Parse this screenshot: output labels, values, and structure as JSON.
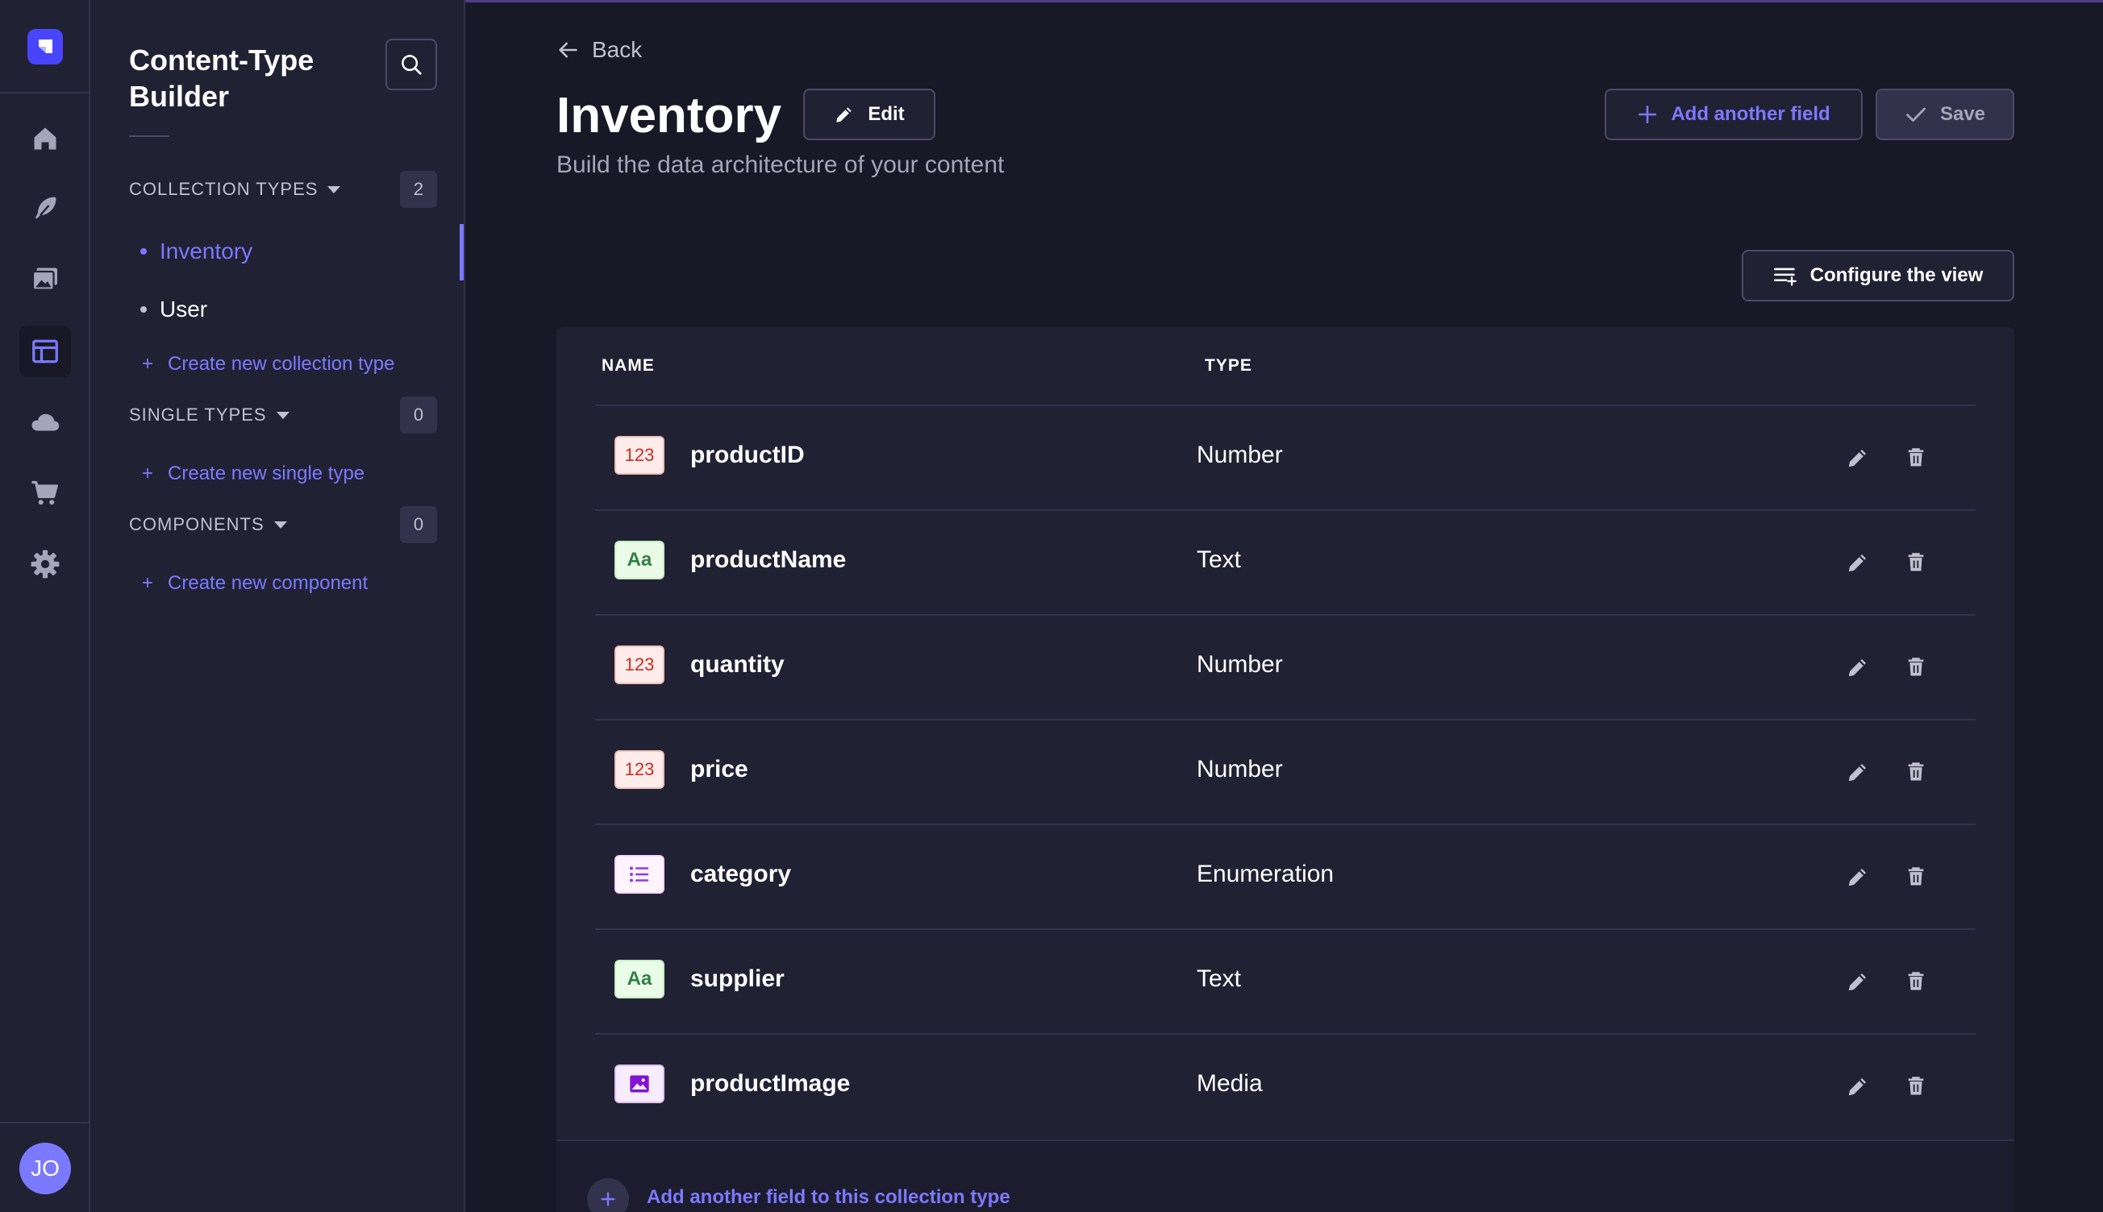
{
  "user": {
    "initials": "JO"
  },
  "sidebar": {
    "title": "Content-Type Builder",
    "sections": [
      {
        "label": "COLLECTION TYPES",
        "count": "2",
        "items": [
          "Inventory",
          "User"
        ],
        "active": "Inventory",
        "create_label": "Create new collection type"
      },
      {
        "label": "SINGLE TYPES",
        "count": "0",
        "items": [],
        "create_label": "Create new single type"
      },
      {
        "label": "COMPONENTS",
        "count": "0",
        "items": [],
        "create_label": "Create new component"
      }
    ]
  },
  "header": {
    "back_label": "Back",
    "title": "Inventory",
    "edit_label": "Edit",
    "add_field_label": "Add another field",
    "save_label": "Save",
    "subtitle": "Build the data architecture of your content",
    "configure_label": "Configure the view"
  },
  "table": {
    "columns": [
      "NAME",
      "TYPE"
    ],
    "rows": [
      {
        "name": "productID",
        "type": "Number",
        "badge": "123",
        "kind": "number"
      },
      {
        "name": "productName",
        "type": "Text",
        "badge": "Aa",
        "kind": "text"
      },
      {
        "name": "quantity",
        "type": "Number",
        "badge": "123",
        "kind": "number"
      },
      {
        "name": "price",
        "type": "Number",
        "badge": "123",
        "kind": "number"
      },
      {
        "name": "category",
        "type": "Enumeration",
        "badge": "",
        "kind": "enum"
      },
      {
        "name": "supplier",
        "type": "Text",
        "badge": "Aa",
        "kind": "text"
      },
      {
        "name": "productImage",
        "type": "Media",
        "badge": "",
        "kind": "media"
      }
    ],
    "footer_label": "Add another field to this collection type"
  },
  "colors": {
    "accent": "#7b79ff",
    "brand": "#4945ff",
    "background": "#181826",
    "panel": "#212134",
    "number_badge": "#d02b20",
    "text_badge": "#328048",
    "enum_badge": "#9736e8",
    "media_badge": "#8312d1"
  },
  "icons": {
    "rail": [
      "home-icon",
      "feather-icon",
      "media-library-icon",
      "layout-icon",
      "cloud-icon",
      "cart-icon",
      "gear-icon"
    ],
    "row_actions": [
      "pencil-icon",
      "trash-icon"
    ]
  }
}
